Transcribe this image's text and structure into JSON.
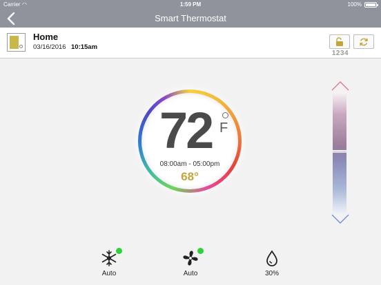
{
  "status_bar": {
    "carrier": "Carrier",
    "time": "1:59 PM",
    "battery": "100%"
  },
  "nav": {
    "title": "Smart Thermostat"
  },
  "location": {
    "name": "Home",
    "date": "03/16/2016",
    "time": "10:15am",
    "lock_code": "1234"
  },
  "thermostat": {
    "temperature": "72",
    "unit": "F",
    "schedule": "08:00am - 05:00pm",
    "setpoint": "68°"
  },
  "modes": {
    "system": "Auto",
    "fan": "Auto",
    "humidity": "30%"
  },
  "colors": {
    "nav": "#8e939c",
    "accent": "#c2a63a",
    "status_on": "#2bd23a"
  }
}
